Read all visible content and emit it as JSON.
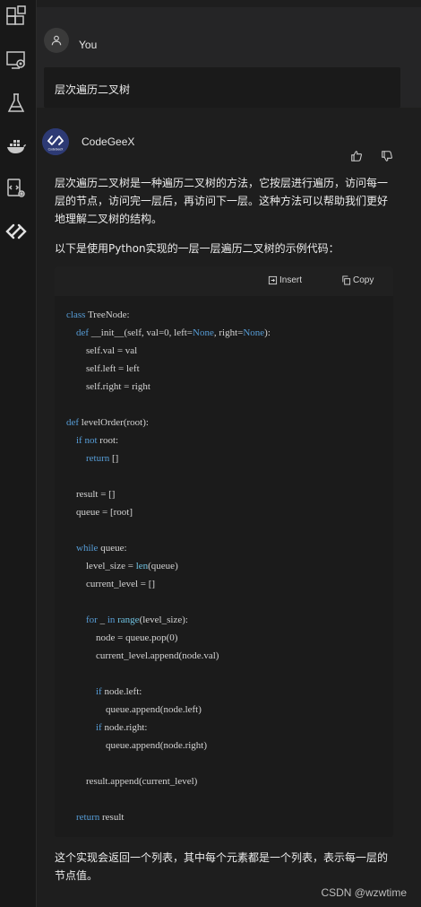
{
  "user": {
    "name": "You",
    "message": "层次遍历二叉树"
  },
  "bot": {
    "name": "CodeGeeX",
    "avatar_text": "CodeGeeX",
    "intro": "层次遍历二叉树是一种遍历二叉树的方法，它按层进行遍历，访问每一层的节点，访问完一层后，再访问下一层。这种方法可以帮助我们更好地理解二叉树的结构。",
    "lead": "以下是使用Python实现的一层一层遍历二叉树的示例代码：",
    "outro": "这个实现会返回一个列表，其中每个元素都是一个列表，表示每一层的节点值。"
  },
  "code_actions": {
    "insert_label": "Insert",
    "copy_label": "Copy"
  },
  "code_lines": [
    "class TreeNode:",
    "    def __init__(self, val=0, left=None, right=None):",
    "        self.val = val",
    "        self.left = left",
    "        self.right = right",
    "",
    "def levelOrder(root):",
    "    if not root:",
    "        return []",
    "",
    "    result = []",
    "    queue = [root]",
    "",
    "    while queue:",
    "        level_size = len(queue)",
    "        current_level = []",
    "",
    "        for _ in range(level_size):",
    "            node = queue.pop(0)",
    "            current_level.append(node.val)",
    "",
    "            if node.left:",
    "                queue.append(node.left)",
    "            if node.right:",
    "                queue.append(node.right)",
    "",
    "        result.append(current_level)",
    "",
    "    return result"
  ],
  "sidebar_icons": [
    "extensions-icon",
    "remote-explorer-icon",
    "testing-flask-icon",
    "docker-icon",
    "settings-code-icon",
    "codegeex-icon"
  ],
  "watermark": "CSDN @wzwtime",
  "colors": {
    "keyword": "#569cd6",
    "builtin": "#6fc1e0",
    "background": "#1e1e1e"
  }
}
